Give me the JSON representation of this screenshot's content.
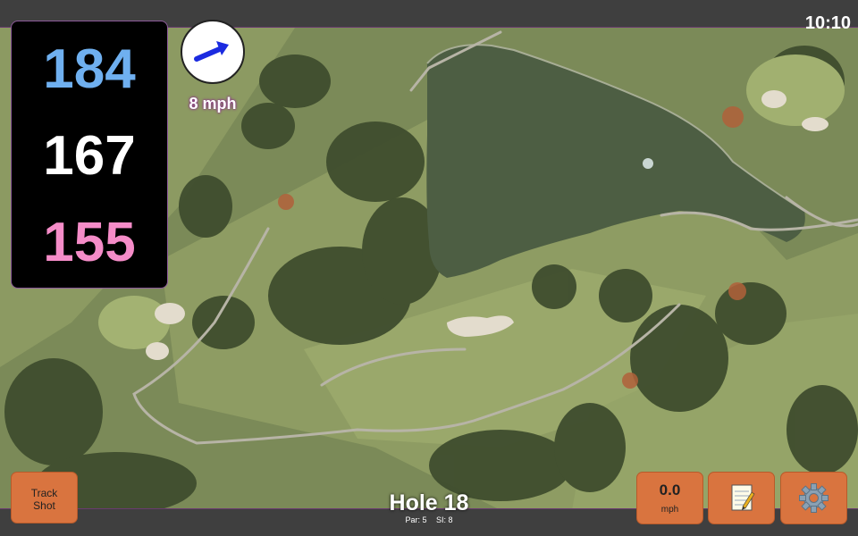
{
  "status": {
    "time": "10:10"
  },
  "yardages": {
    "back": "184",
    "middle": "167",
    "front": "155"
  },
  "wind": {
    "speed_label": "8 mph",
    "direction_icon": "arrow-up-right-icon"
  },
  "buttons": {
    "track_shot_line1": "Track",
    "track_shot_line2": "Shot",
    "speed_value": "0.0",
    "speed_unit": "mph",
    "notes_icon": "notepad-icon",
    "settings_icon": "gear-icon"
  },
  "hole": {
    "title": "Hole 18",
    "par": "Par: 5",
    "si": "SI: 8"
  },
  "colors": {
    "back_yardage": "#6fb0f0",
    "middle_yardage": "#ffffff",
    "front_yardage": "#f58cc8",
    "button": "#d9743f",
    "wind_arrow": "#1b2be0"
  }
}
